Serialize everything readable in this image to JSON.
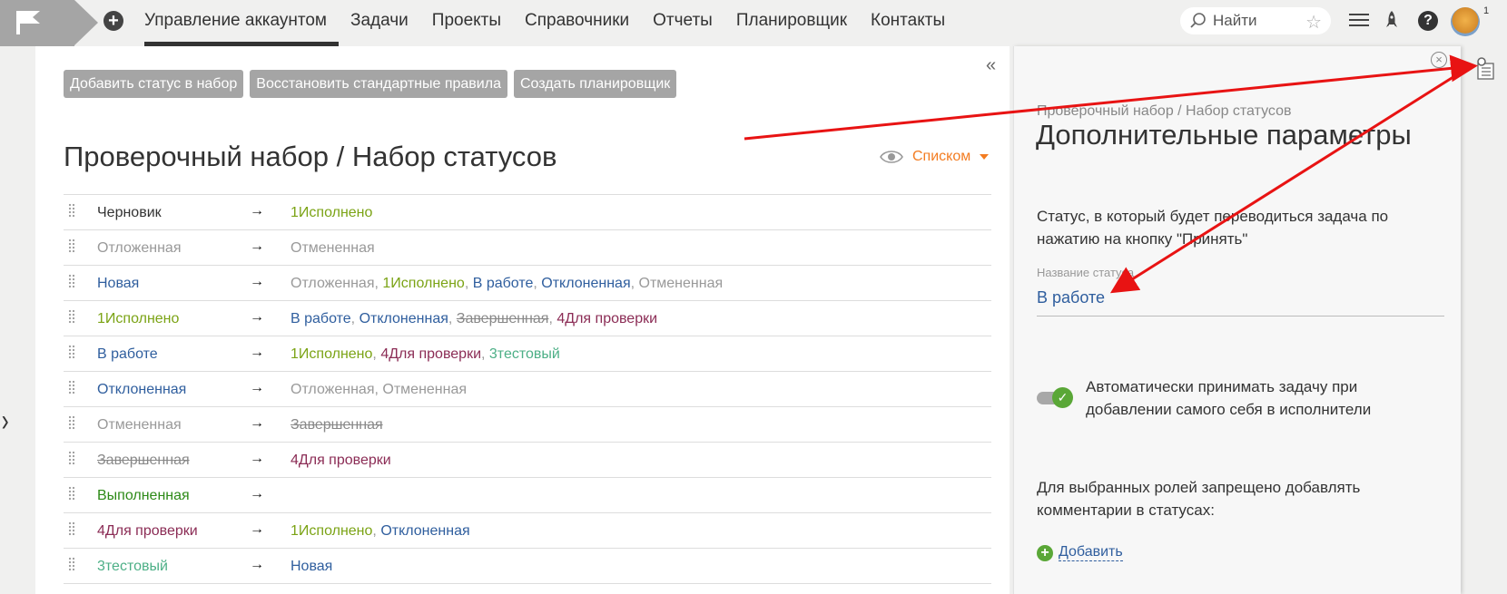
{
  "nav": {
    "items": [
      "Управление аккаунтом",
      "Задачи",
      "Проекты",
      "Справочники",
      "Отчеты",
      "Планировщик",
      "Контакты"
    ],
    "active": "Управление аккаунтом"
  },
  "search": {
    "placeholder": "Найти"
  },
  "avatar_badge": "1",
  "toolbar": {
    "add_status": "Добавить статус в набор",
    "restore_rules": "Восстановить стандартные правила",
    "create_scheduler": "Создать планировщик"
  },
  "page_title": "Проверочный набор / Набор статусов",
  "view_switch": {
    "label": "Списком"
  },
  "colors": {
    "gray": "#999999",
    "blue": "#2f5e9e",
    "olive": "#7ba315",
    "purple": "#8b2c55",
    "teal": "#4caf86",
    "green": "#2d8a17",
    "accent_orange": "#f37c21",
    "arrow_red": "#e81313"
  },
  "rows": [
    {
      "from": {
        "text": "Черновик",
        "color": "dark"
      },
      "to": [
        {
          "text": "1Исполнено",
          "color": "olive"
        }
      ]
    },
    {
      "from": {
        "text": "Отложенная",
        "color": "gray"
      },
      "to": [
        {
          "text": "Отмененная",
          "color": "gray"
        }
      ]
    },
    {
      "from": {
        "text": "Новая",
        "color": "blue"
      },
      "to": [
        {
          "text": "Отложенная",
          "color": "gray"
        },
        {
          "text": "1Исполнено",
          "color": "olive"
        },
        {
          "text": "В работе",
          "color": "blue"
        },
        {
          "text": "Отклоненная",
          "color": "blue"
        },
        {
          "text": "Отмененная",
          "color": "gray"
        }
      ]
    },
    {
      "from": {
        "text": "1Исполнено",
        "color": "olive"
      },
      "to": [
        {
          "text": "В работе",
          "color": "blue"
        },
        {
          "text": "Отклоненная",
          "color": "blue"
        },
        {
          "text": "Завершенная",
          "color": "strike"
        },
        {
          "text": "4Для проверки",
          "color": "purple"
        }
      ]
    },
    {
      "from": {
        "text": "В работе",
        "color": "blue"
      },
      "to": [
        {
          "text": "1Исполнено",
          "color": "olive"
        },
        {
          "text": "4Для проверки",
          "color": "purple"
        },
        {
          "text": "3тестовый",
          "color": "teal"
        }
      ]
    },
    {
      "from": {
        "text": "Отклоненная",
        "color": "blue"
      },
      "to": [
        {
          "text": "Отложенная",
          "color": "gray"
        },
        {
          "text": "Отмененная",
          "color": "gray"
        }
      ]
    },
    {
      "from": {
        "text": "Отмененная",
        "color": "gray"
      },
      "to": [
        {
          "text": "Завершенная",
          "color": "strike"
        }
      ]
    },
    {
      "from": {
        "text": "Завершенная",
        "color": "strike"
      },
      "to": [
        {
          "text": "4Для проверки",
          "color": "purple"
        }
      ]
    },
    {
      "from": {
        "text": "Выполненная",
        "color": "green"
      },
      "to": []
    },
    {
      "from": {
        "text": "4Для проверки",
        "color": "purple"
      },
      "to": [
        {
          "text": "1Исполнено",
          "color": "olive"
        },
        {
          "text": "Отклоненная",
          "color": "blue"
        }
      ]
    },
    {
      "from": {
        "text": "3тестовый",
        "color": "teal"
      },
      "to": [
        {
          "text": "Новая",
          "color": "blue"
        }
      ]
    }
  ],
  "panel": {
    "breadcrumb": "Проверочный набор / Набор статусов",
    "title": "Дополнительные параметры",
    "accept_text_1": "Статус, в который будет переводиться задача по",
    "accept_text_2": "нажатию на кнопку \"Принять\"",
    "field_label": "Название статуса",
    "field_value": "В работе",
    "toggle_on": true,
    "toggle_text_1": "Автоматически принимать задачу при",
    "toggle_text_2": "добавлении самого себя в исполнители",
    "roles_text_1": "Для выбранных ролей запрещено добавлять",
    "roles_text_2": "комментарии в статусах:",
    "add_label": "Добавить"
  }
}
